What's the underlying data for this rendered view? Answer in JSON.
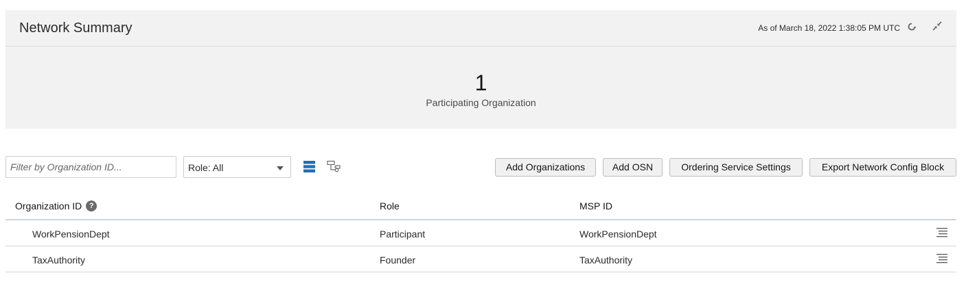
{
  "summary": {
    "title": "Network Summary",
    "as_of": "As of March 18, 2022 1:38:05 PM UTC",
    "refresh_icon": "refresh-icon",
    "collapse_icon": "collapse-icon",
    "count": "1",
    "count_label": "Participating Organization"
  },
  "toolbar": {
    "filter_placeholder": "Filter by Organization ID...",
    "filter_value": "",
    "role_select": "Role: All",
    "list_view_icon": "list-view-icon",
    "topology_view_icon": "topology-view-icon",
    "add_organizations": "Add Organizations",
    "add_osn": "Add OSN",
    "ordering_service_settings": "Ordering Service Settings",
    "export_network_config_block": "Export Network Config Block"
  },
  "table": {
    "headers": {
      "org_id": "Organization ID",
      "role": "Role",
      "msp_id": "MSP ID"
    },
    "help_icon_glyph": "?",
    "rows": [
      {
        "org_id": "WorkPensionDept",
        "role": "Participant",
        "msp_id": "WorkPensionDept"
      },
      {
        "org_id": "TaxAuthority",
        "role": "Founder",
        "msp_id": "TaxAuthority"
      }
    ]
  },
  "colors": {
    "accent": "#1f6fb5",
    "panel_bg": "#f2f2f2"
  }
}
